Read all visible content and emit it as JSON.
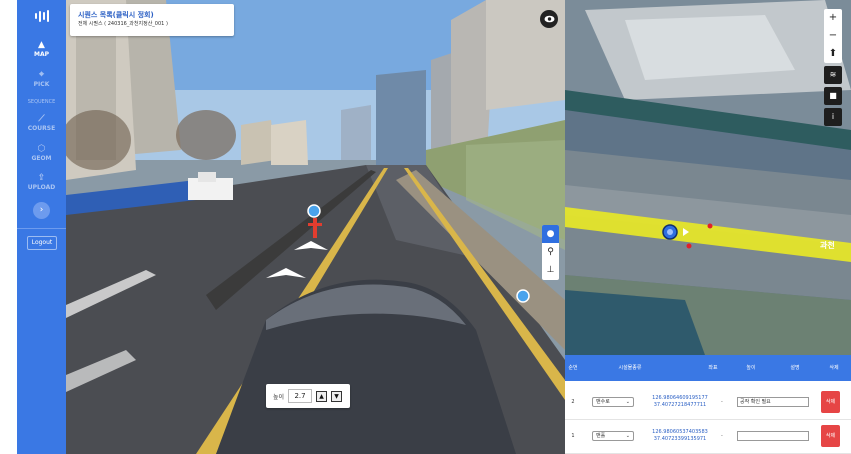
{
  "sidebar": {
    "items": [
      {
        "icon": "map-icon",
        "label": "MAP"
      },
      {
        "icon": "pick-icon",
        "label": "PICK"
      },
      {
        "icon": "sequence-icon",
        "label": "SEQUENCE"
      },
      {
        "icon": "course-icon",
        "label": "COURSE"
      },
      {
        "icon": "geom-icon",
        "label": "GEOM"
      },
      {
        "icon": "upload-icon",
        "label": "UPLOAD"
      }
    ],
    "expand_glyph": "›",
    "logout_label": "Logout"
  },
  "streetview": {
    "title": "시퀀스 목록(클릭시 정회)",
    "subtitle": "전체 시퀀스 ( 240316_과천지정산_001 )",
    "height_label": "높이",
    "height_value": "2.7",
    "up_glyph": "▲",
    "down_glyph": "▼"
  },
  "map": {
    "zoom_in": "+",
    "zoom_out": "−",
    "compass": "⬆",
    "road_label": "과천"
  },
  "table": {
    "headers": {
      "num": "순번",
      "type": "시설물종류",
      "coord": "좌표",
      "dash": "높이",
      "note": "설명",
      "delete": "삭제"
    },
    "rows": [
      {
        "num": "2",
        "type": "맨수로",
        "coord_x": "126.98064609195177",
        "coord_y": "37.40727218477711",
        "dash": "-",
        "note": "공작 확인 필요",
        "delete": "삭제"
      },
      {
        "num": "1",
        "type": "맨홀",
        "coord_x": "126.98060537403583",
        "coord_y": "37.40723399135971",
        "dash": "-",
        "note": "",
        "delete": "삭제"
      }
    ]
  },
  "colors": {
    "sidebar": "#3a78e4",
    "accent": "#2f6fe0",
    "delete": "#e64545"
  }
}
